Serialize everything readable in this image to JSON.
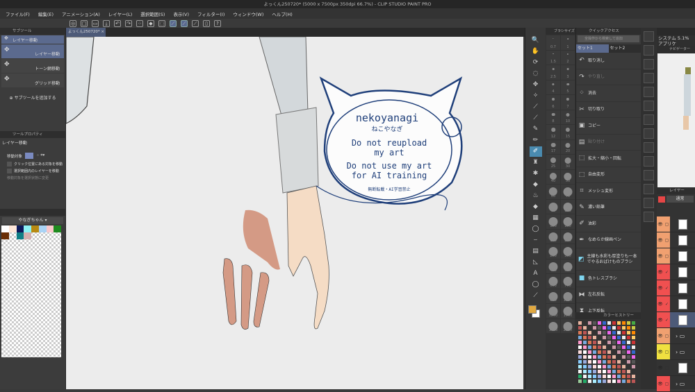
{
  "window": {
    "title": "よっくん250720* (5000 x 7500px 350dpi 66.7%)  - CLIP STUDIO PAINT PRO"
  },
  "menu": [
    "ファイル(F)",
    "編集(E)",
    "アニメーション(A)",
    "レイヤー(L)",
    "選択範囲(S)",
    "表示(V)",
    "フィルター(I)",
    "ウィンドウ(W)",
    "ヘルプ(H)"
  ],
  "canvas_tab": {
    "label": "よっくん250720*",
    "close": "×"
  },
  "subtool": {
    "panel_title": "サブツール",
    "group": "レイヤー移動",
    "items": [
      "レイヤー移動",
      "トーン網移動",
      "グリッド移動"
    ],
    "add_label": "サブツールを追加する"
  },
  "tool_property": {
    "panel_title": "ツールプロパティ",
    "tool_name": "レイヤー移動",
    "move_target_label": "移動対象",
    "options": [
      "クリック位置にある対象を移動",
      "選択範囲内のレイヤーを移動",
      "移動対象を選択状態に変更"
    ]
  },
  "color_set": {
    "name": "やなぎちゃん",
    "colors": [
      "#ffffff",
      "#fde6d8",
      "#0d1a5a",
      "#8ef2f5",
      "#b88a12",
      "#a9d3f5",
      "#f9c8cc",
      "#1e8a1e",
      "#6a2e05",
      "#ffffff",
      "#0f7f86",
      "#d4b0b0"
    ]
  },
  "brush_sizes": [
    "0.7",
    "1",
    "1.5",
    "2",
    "2.5",
    "3",
    "4",
    "5",
    "6",
    "7",
    "8",
    "10",
    "12",
    "15",
    "17",
    "20",
    "25",
    "30",
    "40",
    "50",
    "60",
    "70",
    "80",
    "100",
    "120",
    "150",
    "170",
    "200",
    "250",
    "300",
    "400",
    "500",
    "600",
    "700",
    "800",
    "1000",
    "1200",
    "1500",
    "1700",
    "2000"
  ],
  "brush_panel_title": "ブラシサイズ",
  "quick_access": {
    "panel_title": "クイックアクセス",
    "search_placeholder": "全操作から検索して追加",
    "sets": [
      "セット1",
      "セット2"
    ],
    "items": [
      {
        "label": "取り消し",
        "icon": "undo-icon",
        "glyph": "↶",
        "dim": false
      },
      {
        "label": "やり直し",
        "icon": "redo-icon",
        "glyph": "↷",
        "dim": true
      },
      {
        "label": "消去",
        "icon": "clear-icon",
        "glyph": "⁘",
        "dim": false
      },
      {
        "label": "切り取り",
        "icon": "scissors-icon",
        "glyph": "✂",
        "dim": false
      },
      {
        "label": "コピー",
        "icon": "copy-icon",
        "glyph": "▣",
        "dim": false
      },
      {
        "label": "貼り付け",
        "icon": "paste-icon",
        "glyph": "▤",
        "dim": true
      },
      {
        "label": "拡大・縮小・回転",
        "icon": "scale-icon",
        "glyph": "⬚",
        "dim": false
      },
      {
        "label": "自由変形",
        "icon": "free-transform-icon",
        "glyph": "⬚",
        "dim": false
      },
      {
        "label": "メッシュ変形",
        "icon": "mesh-icon",
        "glyph": "⌗",
        "dim": false
      },
      {
        "label": "濃い鉛筆",
        "icon": "pencil-icon",
        "glyph": "✎",
        "dim": false
      },
      {
        "label": "油彩",
        "icon": "oil-brush-icon",
        "glyph": "✐",
        "dim": false
      },
      {
        "label": "なめらか線画ペン",
        "icon": "pen-icon",
        "glyph": "✒",
        "dim": false
      },
      {
        "label": "主線も水彩も厚塗りも一本でやるおばけものブラシ",
        "icon": "brush-icon",
        "glyph": "◩",
        "dim": false
      },
      {
        "label": "色トレスブラシ",
        "icon": "color-trace-icon",
        "glyph": "■",
        "dim": false
      },
      {
        "label": "左右反転",
        "icon": "flip-horizontal-icon",
        "glyph": "⧓",
        "dim": false
      },
      {
        "label": "上下反転",
        "icon": "flip-vertical-icon",
        "glyph": "⧗",
        "dim": false
      }
    ]
  },
  "color_history": {
    "panel_title": "カラーヒストリー",
    "palette": [
      "#e8b4a0",
      "#c33",
      "#f5f5f5",
      "#7ad",
      "#e6e",
      "#4a4",
      "#fdd",
      "#333",
      "#fc6",
      "#aef",
      "#d75",
      "#36c",
      "#9c9",
      "#fff",
      "#c9a",
      "#f80",
      "#8cf",
      "#b55",
      "#eee",
      "#2a6",
      "#f9c",
      "#555",
      "#cc4",
      "#9ad"
    ]
  },
  "navigator": {
    "panel_title": "ナビゲーター",
    "system_label": "システム 5.1%",
    "app_label": "アプリケ"
  },
  "layers": {
    "panel_title": "レイヤー",
    "blend_mode": "通常",
    "accent": "#e64646"
  },
  "stamp": {
    "name": "nekoyanagi",
    "name_kana": "ねこやなぎ",
    "line1": "Do not reupload",
    "line2": "my art",
    "line3": "Do not use my art",
    "line4": "for AI training",
    "footer": "無断転載・AI学習禁止",
    "color": "#1f3f7a"
  },
  "colors": {
    "main": "#e0a840",
    "sub": "#ffffff"
  }
}
